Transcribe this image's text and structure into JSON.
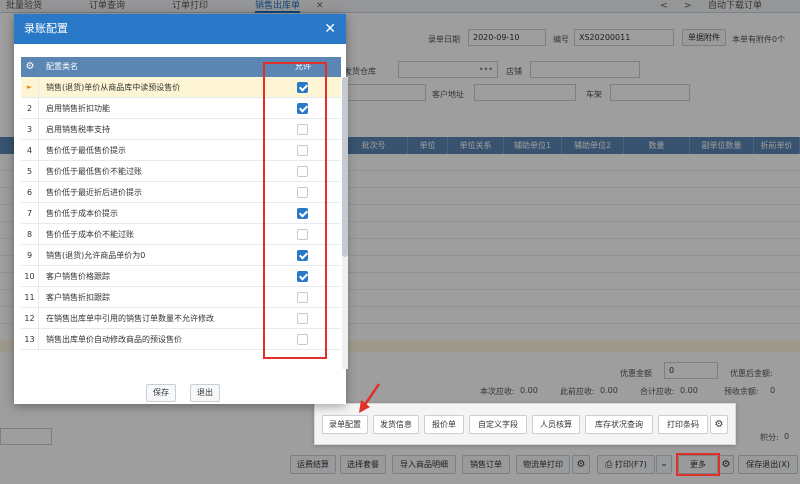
{
  "tabs": [
    "批量验货",
    "订单查询",
    "订单打印",
    "销售出库单"
  ],
  "tab_close": "✕",
  "top_right": {
    "nav_prev": "<",
    "nav_next": ">",
    "label": "自动下载订单"
  },
  "form": {
    "date_label": "录单日期",
    "date_value": "2020-09-10",
    "no_label": "编号",
    "no_value": "XS20200011",
    "attach_button": "单据附件",
    "attach_note": "本单有附件0个",
    "warehouse_label": "发货仓库",
    "store_label": "店铺",
    "address_label": "客户地址",
    "shelf_label": "车架",
    "ellipsis": "•••"
  },
  "grid_headers": [
    "批次号",
    "单位",
    "单位关系",
    "辅助单位1",
    "辅助单位2",
    "数量",
    "副单位数量",
    "折前单价"
  ],
  "bottom_form": {
    "discount_amount": "优惠金额",
    "discount_value": "0",
    "after_discount": "优惠后金额:",
    "this_receivable": "本次应收:",
    "this_receivable_value": "0.00",
    "before_receivable": "此前应收:",
    "before_receivable_value": "0.00",
    "total_receivable": "合计应收:",
    "total_receivable_value": "0.00",
    "prepaid_balance": "预收余额:",
    "prepaid_value": "0",
    "points": "积分:",
    "points_value": "0"
  },
  "dialog": {
    "title": "录账配置",
    "close": "✕",
    "col_name": "配置类名",
    "col_allow": "允许",
    "rows": [
      {
        "n": "",
        "name": "销售(退货)单价从商品库中读预设售价",
        "checked": true
      },
      {
        "n": "2",
        "name": "启用销售折扣功能",
        "checked": true
      },
      {
        "n": "3",
        "name": "启用销售税率支持",
        "checked": false
      },
      {
        "n": "4",
        "name": "售价低于最低售价提示",
        "checked": false
      },
      {
        "n": "5",
        "name": "售价低于最低售价不能过账",
        "checked": false
      },
      {
        "n": "6",
        "name": "售价低于最近折后进价提示",
        "checked": false
      },
      {
        "n": "7",
        "name": "售价低于成本价提示",
        "checked": true
      },
      {
        "n": "8",
        "name": "售价低于成本价不能过账",
        "checked": false
      },
      {
        "n": "9",
        "name": "销售(退货)允许商品单价为0",
        "checked": true
      },
      {
        "n": "10",
        "name": "客户销售价格跟踪",
        "checked": true
      },
      {
        "n": "11",
        "name": "客户销售折扣跟踪",
        "checked": false
      },
      {
        "n": "12",
        "name": "在销售出库单中引用的销售订单数量不允许修改",
        "checked": false
      },
      {
        "n": "13",
        "name": "销售出库单价自动修改商品的预设售价",
        "checked": false
      }
    ],
    "save": "保存",
    "exit": "退出"
  },
  "popover": [
    "录单配置",
    "发货信息",
    "报价单",
    "自定义字段",
    "人员核算",
    "库存状况查询",
    "打印条码"
  ],
  "bottom_buttons": [
    "运费结算",
    "选择套餐",
    "导入商品明细",
    "销售订单",
    "物流单打印",
    "打印(F7)",
    "更多",
    "保存退出(X)"
  ],
  "colors": {
    "accent": "#2a79c8",
    "header": "#5b86b4",
    "highlight": "#e0302a"
  }
}
